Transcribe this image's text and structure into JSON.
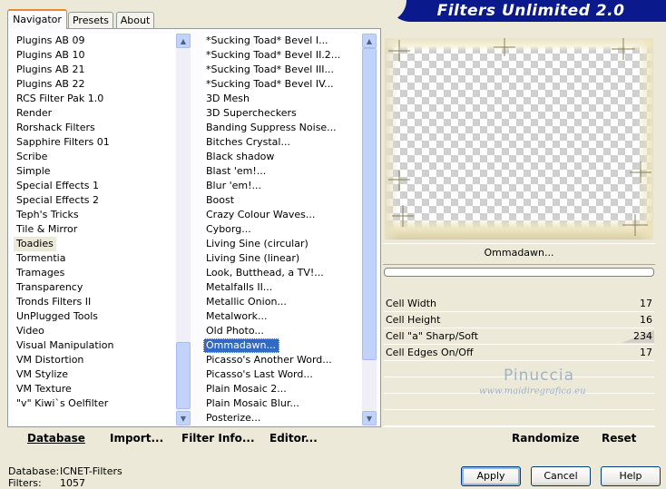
{
  "tabs": [
    {
      "label": "Navigator",
      "active": true
    },
    {
      "label": "Presets",
      "active": false
    },
    {
      "label": "About",
      "active": false
    }
  ],
  "banner": {
    "title": "Filters Unlimited 2.0"
  },
  "categories": {
    "items": [
      "Plugins AB 09",
      "Plugins AB 10",
      "Plugins AB 21",
      "Plugins AB 22",
      "RCS Filter Pak 1.0",
      "Render",
      "Rorshack Filters",
      "Sapphire Filters 01",
      "Scribe",
      "Simple",
      "Special Effects 1",
      "Special Effects 2",
      "Teph's Tricks",
      "Tile & Mirror",
      "Toadies",
      "Tormentia",
      "Tramages",
      "Transparency",
      "Tronds Filters II",
      "UnPlugged Tools",
      "Video",
      "Visual Manipulation",
      "VM Distortion",
      "VM Stylize",
      "VM Texture",
      "\"v\" Kiwi`s Oelfilter"
    ],
    "selected": "Toadies"
  },
  "filters": {
    "items": [
      "*Sucking Toad*  Bevel I...",
      "*Sucking Toad*  Bevel II.2...",
      "*Sucking Toad*  Bevel III...",
      "*Sucking Toad*  Bevel IV...",
      "3D Mesh",
      "3D Supercheckers",
      "Banding Suppress Noise...",
      "Bitches Crystal...",
      "Black shadow",
      "Blast 'em!...",
      "Blur 'em!...",
      "Boost",
      "Crazy Colour Waves...",
      "Cyborg...",
      "Living Sine (circular)",
      "Living Sine (linear)",
      "Look, Butthead, a TV!...",
      "Metalfalls II...",
      "Metallic Onion...",
      "Metalwork...",
      "Old Photo...",
      "Ommadawn...",
      "Picasso's Another Word...",
      "Picasso's Last Word...",
      "Plain Mosaic 2...",
      "Plain Mosaic Blur...",
      "Posterize..."
    ],
    "selected": "Ommadawn..."
  },
  "toolbar": {
    "database": "Database",
    "import": "Import...",
    "filter_info": "Filter Info...",
    "editor": "Editor..."
  },
  "preview": {
    "filter_name": "Ommadawn..."
  },
  "parameters": [
    {
      "label": "Cell Width",
      "value": "17"
    },
    {
      "label": "Cell Height",
      "value": "16"
    },
    {
      "label": "Cell \"a\" Sharp/Soft",
      "value": "234"
    },
    {
      "label": "Cell Edges On/Off",
      "value": "17"
    }
  ],
  "watermark": {
    "name": "Pinuccia",
    "url": "www.maidiregrafica.eu"
  },
  "right_buttons": {
    "randomize": "Randomize",
    "reset": "Reset"
  },
  "status": {
    "database_label": "Database:",
    "database_value": "ICNET-Filters",
    "filters_label": "Filters:",
    "filters_value": "1057"
  },
  "dialog_buttons": {
    "apply": "Apply",
    "cancel": "Cancel",
    "help": "Help"
  }
}
